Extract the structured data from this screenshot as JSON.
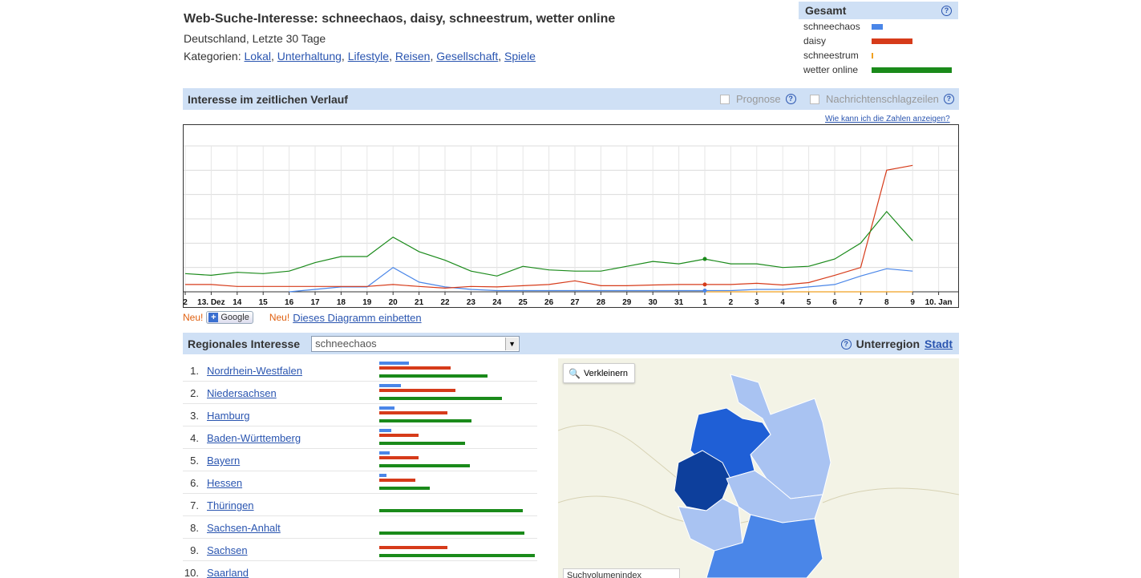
{
  "header": {
    "title": "Web-Suche-Interesse: schneechaos, daisy, schneestrum, wetter online",
    "subtitle": "Deutschland, Letzte 30 Tage",
    "categories_label": "Kategorien:",
    "categories": [
      "Lokal",
      "Unterhaltung",
      "Lifestyle",
      "Reisen",
      "Gesellschaft",
      "Spiele"
    ]
  },
  "gesamt": {
    "title": "Gesamt",
    "help_icon": "help-icon",
    "terms": [
      {
        "label": "schneechaos",
        "color": "#4a86e8",
        "value": 14
      },
      {
        "label": "daisy",
        "color": "#d63b1a",
        "value": 51
      },
      {
        "label": "schneestrum",
        "color": "#f0a020",
        "value": 2
      },
      {
        "label": "wetter online",
        "color": "#1a8a1a",
        "value": 100
      }
    ]
  },
  "timeline": {
    "title": "Interesse im zeitlichen Verlauf",
    "option_forecast": "Prognose",
    "option_news": "Nachrichtenschlagzeilen",
    "howto_link": "Wie kann ich die Zahlen anzeigen?"
  },
  "chart_data": {
    "type": "line",
    "x": [
      "2",
      "13. Dez",
      "14",
      "15",
      "16",
      "17",
      "18",
      "19",
      "20",
      "21",
      "22",
      "23",
      "24",
      "25",
      "26",
      "27",
      "28",
      "29",
      "30",
      "31",
      "1",
      "2",
      "3",
      "4",
      "5",
      "6",
      "7",
      "8",
      "9",
      "10. Jan",
      "1"
    ],
    "ylim": [
      0,
      6
    ],
    "grid": true,
    "series": [
      {
        "name": "schneechaos",
        "color": "#4a86e8",
        "values": [
          null,
          null,
          null,
          null,
          0,
          0.1,
          0.2,
          0.2,
          1.0,
          0.4,
          0.2,
          0.1,
          0.05,
          0.05,
          0.05,
          0.05,
          0.05,
          0.05,
          0.05,
          0.05,
          0.05,
          0.05,
          0.1,
          0.1,
          0.2,
          0.3,
          0.65,
          0.95,
          0.85,
          null,
          null
        ]
      },
      {
        "name": "daisy",
        "color": "#d63b1a",
        "values": [
          0.3,
          0.3,
          0.22,
          0.22,
          0.22,
          0.22,
          0.22,
          0.22,
          0.3,
          0.22,
          0.15,
          0.22,
          0.2,
          0.25,
          0.3,
          0.45,
          0.25,
          0.25,
          0.28,
          0.3,
          0.3,
          0.3,
          0.35,
          0.28,
          0.38,
          0.68,
          1.0,
          5.0,
          5.2,
          null,
          null
        ]
      },
      {
        "name": "schneestrum",
        "color": "#f0a020",
        "values": [
          null,
          null,
          null,
          null,
          null,
          null,
          null,
          null,
          null,
          null,
          null,
          null,
          null,
          null,
          null,
          null,
          null,
          null,
          null,
          null,
          0,
          0,
          0,
          0,
          0,
          0,
          0,
          0,
          0,
          null,
          null
        ]
      },
      {
        "name": "wetter online",
        "color": "#1a8a1a",
        "values": [
          0.75,
          0.68,
          0.8,
          0.75,
          0.85,
          1.2,
          1.45,
          1.45,
          2.25,
          1.65,
          1.3,
          0.85,
          0.65,
          1.05,
          0.9,
          0.85,
          0.85,
          1.05,
          1.25,
          1.15,
          1.35,
          1.15,
          1.15,
          1.0,
          1.05,
          1.35,
          2.0,
          3.3,
          2.1,
          null,
          null
        ]
      }
    ],
    "markers": [
      {
        "series": "wetter online",
        "index": 20
      },
      {
        "series": "daisy",
        "index": 20
      },
      {
        "series": "schneechaos",
        "index": 20
      }
    ]
  },
  "embed": {
    "neu1": "Neu!",
    "google_button": "Google",
    "neu2": "Neu!",
    "embed_link": "Dieses Diagramm einbetten"
  },
  "regional": {
    "title": "Regionales Interesse",
    "selected": "schneechaos",
    "subregion_label": "Unterregion",
    "city_link": "Stadt",
    "rows": [
      {
        "rank": "1.",
        "name": "Nordrhein-Westfalen",
        "schneechaos": 37,
        "daisy": 89,
        "wetter": 135
      },
      {
        "rank": "2.",
        "name": "Niedersachsen",
        "schneechaos": 27,
        "daisy": 95,
        "wetter": 153
      },
      {
        "rank": "3.",
        "name": "Hamburg",
        "schneechaos": 19,
        "daisy": 85,
        "wetter": 115
      },
      {
        "rank": "4.",
        "name": "Baden-Württemberg",
        "schneechaos": 15,
        "daisy": 49,
        "wetter": 107
      },
      {
        "rank": "5.",
        "name": "Bayern",
        "schneechaos": 13,
        "daisy": 49,
        "wetter": 113
      },
      {
        "rank": "6.",
        "name": "Hessen",
        "schneechaos": 9,
        "daisy": 45,
        "wetter": 63
      },
      {
        "rank": "7.",
        "name": "Thüringen",
        "schneechaos": 0,
        "daisy": 0,
        "wetter": 179
      },
      {
        "rank": "8.",
        "name": "Sachsen-Anhalt",
        "schneechaos": 0,
        "daisy": 0,
        "wetter": 181
      },
      {
        "rank": "9.",
        "name": "Sachsen",
        "schneechaos": 0,
        "daisy": 85,
        "wetter": 194
      },
      {
        "rank": "10.",
        "name": "Saarland",
        "schneechaos": 0,
        "daisy": 0,
        "wetter": 0
      }
    ]
  },
  "map": {
    "zoom_label": "Verkleinern",
    "caption": "Suchvolumenindex"
  },
  "colors": {
    "header_bg": "#cfe0f5",
    "link": "#2a55b0",
    "neu": "#e06010"
  }
}
